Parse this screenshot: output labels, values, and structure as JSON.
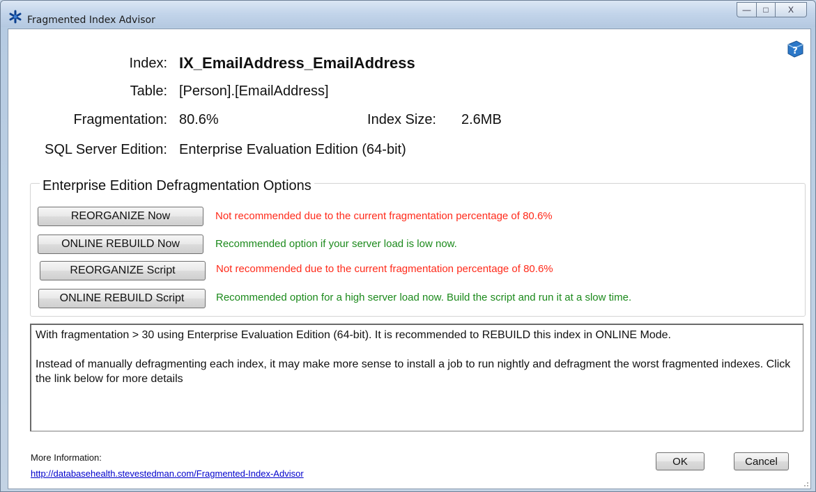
{
  "window": {
    "title": "Fragmented Index Advisor",
    "icon": "snowflake-advisor-icon",
    "controls": {
      "minimize": "—",
      "maximize": "□",
      "close": "X"
    }
  },
  "details": {
    "index_label": "Index:",
    "index_value": "IX_EmailAddress_EmailAddress",
    "table_label": "Table:",
    "table_value": "[Person].[EmailAddress]",
    "fragmentation_label": "Fragmentation:",
    "fragmentation_value": "80.6%",
    "index_size_label": "Index Size:",
    "index_size_value": "2.6MB",
    "edition_label": "SQL Server Edition:",
    "edition_value": "Enterprise Evaluation Edition (64-bit)"
  },
  "options": {
    "title": "Enterprise Edition Defragmentation Options",
    "rows": [
      {
        "button": "REORGANIZE Now",
        "note": "Not recommended due to the current fragmentation percentage of 80.6%",
        "status": "red"
      },
      {
        "button": "ONLINE REBUILD Now",
        "note": "Recommended option if your server load is low now.",
        "status": "green"
      },
      {
        "button": "REORGANIZE Script",
        "note": "Not recommended due to the current fragmentation percentage of 80.6%",
        "status": "red"
      },
      {
        "button": "ONLINE REBUILD Script",
        "note": "Recommended option for a high server load now.  Build the script and run it at a slow time.",
        "status": "green"
      }
    ]
  },
  "advice": {
    "paragraph1": "With fragmentation > 30 using Enterprise Evaluation Edition (64-bit).  It is recommended to REBUILD this index in ONLINE Mode.",
    "paragraph2": "Instead of manually defragmenting each index, it may make more sense to install a job to run nightly and defragment the worst fragmented indexes.  Click the link below for more details"
  },
  "footer": {
    "more_info_label": "More Information:",
    "link_text": "http://databasehealth.stevestedman.com/Fragmented-Index-Advisor",
    "ok_label": "OK",
    "cancel_label": "Cancel"
  },
  "colors": {
    "warning": "#ff2a1a",
    "recommended": "#1c8a1c",
    "link": "#0000cc"
  }
}
